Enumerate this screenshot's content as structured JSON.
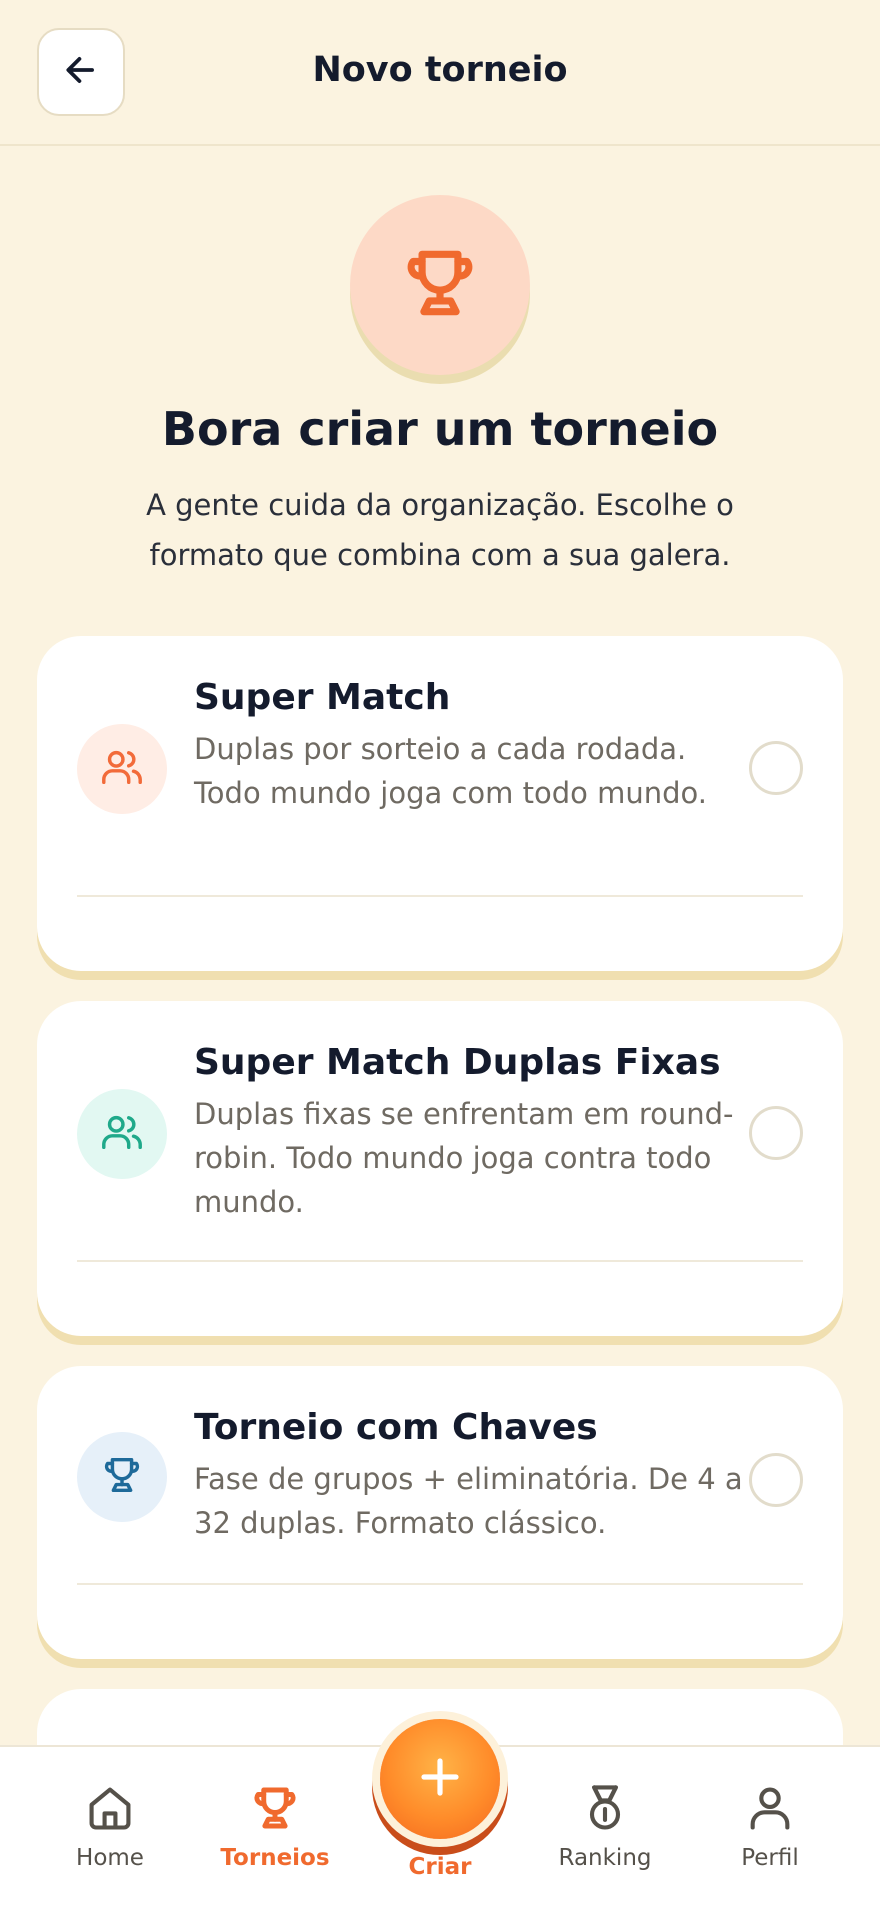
{
  "header": {
    "title": "Novo torneio",
    "back_icon": "arrow-left-icon"
  },
  "hero": {
    "icon": "trophy-icon",
    "title": "Bora criar um torneio",
    "subtitle": "A gente cuida da organização. Escolhe o formato que combina com a sua galera."
  },
  "formats": [
    {
      "title": "Super Match",
      "description": "Duplas por sorteio a cada rodada. Todo mundo joga com todo mundo.",
      "icon": "users-icon",
      "selected": false,
      "color": "#F26B3A",
      "bg": "#FFEDE5"
    },
    {
      "title": "Super Match Duplas Fixas",
      "description": "Duplas fixas se enfrentam em round-robin. Todo mundo joga contra todo mundo.",
      "icon": "users-icon",
      "selected": false,
      "color": "#1FA98A",
      "bg": "#E2F8F2"
    },
    {
      "title": "Torneio com Chaves",
      "description": "Fase de grupos + eliminatória. De 4 a 32 duplas. Formato clássico.",
      "icon": "trophy-icon",
      "selected": false,
      "color": "#1E6A9A",
      "bg": "#E6F0F9"
    }
  ],
  "bottom_nav": {
    "items": [
      {
        "label": "Home",
        "icon": "home-icon",
        "active": false
      },
      {
        "label": "Torneios",
        "icon": "trophy-icon",
        "active": true
      },
      {
        "label": "Ranking",
        "icon": "medal-icon",
        "active": false
      },
      {
        "label": "Perfil",
        "icon": "user-icon",
        "active": false
      }
    ],
    "fab": {
      "label": "Criar",
      "icon": "plus-icon"
    }
  },
  "colors": {
    "accent": "#F06A2E",
    "background": "#FBF3E0",
    "text": "#141B2D"
  }
}
